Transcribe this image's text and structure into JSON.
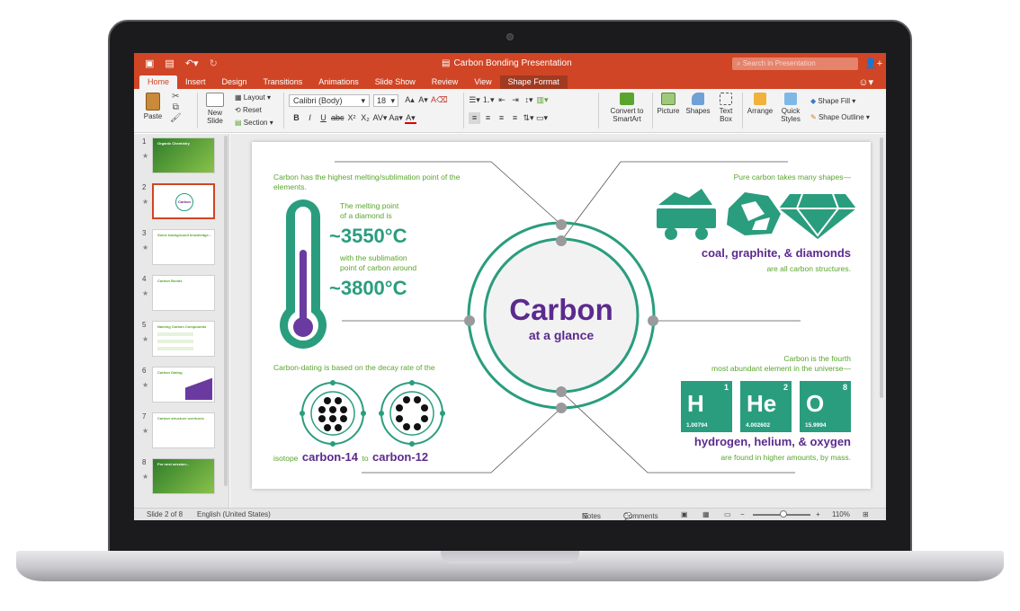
{
  "window": {
    "title": "Carbon Bonding Presentation",
    "search_placeholder": "Search in Presentation"
  },
  "tabs": [
    "Home",
    "Insert",
    "Design",
    "Transitions",
    "Animations",
    "Slide Show",
    "Review",
    "View",
    "Shape Format"
  ],
  "ribbon": {
    "paste": "Paste",
    "new_slide": "New\nSlide",
    "layout": "Layout",
    "reset": "Reset",
    "section": "Section",
    "font_name": "Calibri (Body)",
    "font_size": "18",
    "convert_smartart": "Convert to\nSmartArt",
    "picture": "Picture",
    "shapes": "Shapes",
    "text_box": "Text\nBox",
    "arrange": "Arrange",
    "quick_styles": "Quick\nStyles",
    "shape_fill": "Shape Fill",
    "shape_outline": "Shape Outline"
  },
  "thumbnails": [
    {
      "num": "1",
      "title": "Organic Chemistry"
    },
    {
      "num": "2",
      "title": "Carbon"
    },
    {
      "num": "3",
      "title": "Some background knowledge..."
    },
    {
      "num": "4",
      "title": "Carbon Bonds"
    },
    {
      "num": "5",
      "title": "Naming Carbon Compounds"
    },
    {
      "num": "6",
      "title": "Carbon Dating"
    },
    {
      "num": "7",
      "title": "Carbon structure overtures"
    },
    {
      "num": "8",
      "title": "For next session..."
    }
  ],
  "slide": {
    "melt_intro": "Carbon has the highest melting/sublimation point of the elements.",
    "melt_point_1": "The melting point",
    "melt_point_2": "of a diamond is",
    "temp_diamond": "~3550°C",
    "sub_point_1": "with the sublimation",
    "sub_point_2": "point of carbon around",
    "temp_carbon": "~3800°C",
    "shapes_intro": "Pure carbon takes many shapes—",
    "shapes_list": "coal, graphite, & diamonds",
    "shapes_outro": "are all carbon structures.",
    "center_title": "Carbon",
    "center_sub": "at a glance",
    "dating_intro": "Carbon-dating is based on the decay rate of the",
    "isotope_word": "isotope",
    "c14": "carbon-14",
    "to_word": "to",
    "c12": "carbon-12",
    "abundant_1": "Carbon is the fourth",
    "abundant_2": "most abundant element in the universe—",
    "elements": [
      {
        "symbol": "H",
        "number": "1",
        "mass": "1.00794"
      },
      {
        "symbol": "He",
        "number": "2",
        "mass": "4.002602"
      },
      {
        "symbol": "O",
        "number": "8",
        "mass": "15.9994"
      }
    ],
    "elements_list": "hydrogen, helium, & oxygen",
    "elements_outro": "are found in higher amounts, by mass."
  },
  "status": {
    "slide_info": "Slide 2 of 8",
    "language": "English (United States)",
    "notes": "Notes",
    "comments": "Comments",
    "zoom": "110%"
  },
  "colors": {
    "accent": "#d04525",
    "teal": "#2a9d7e",
    "green": "#5aa52e",
    "purple": "#5c2a8e"
  }
}
